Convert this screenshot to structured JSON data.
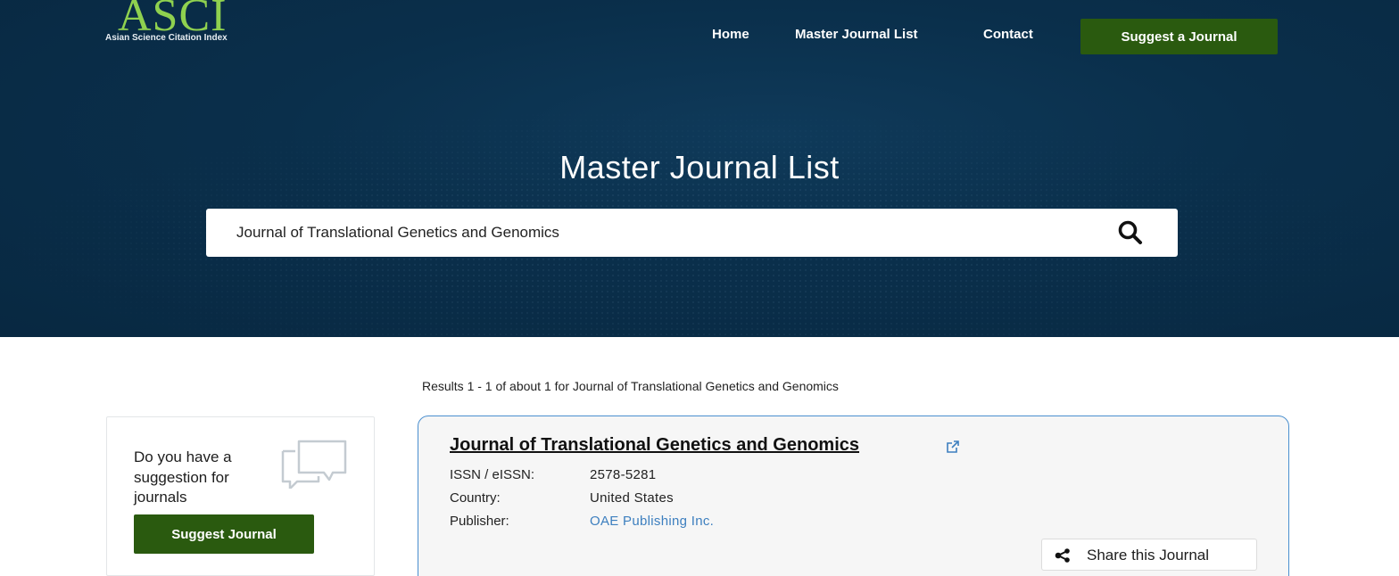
{
  "header": {
    "logo_text": "ASCI",
    "logo_subtitle": "Asian Science Citation Index",
    "nav": {
      "home": "Home",
      "master_journal_list": "Master Journal List",
      "contact": "Contact"
    },
    "suggest_button": "Suggest a Journal"
  },
  "hero": {
    "title": "Master Journal List",
    "search": {
      "value": "Journal of Translational Genetics and Genomics"
    }
  },
  "results": {
    "summary": "Results 1 - 1 of about 1 for Journal of Translational Genetics and Genomics"
  },
  "sidebar": {
    "prompt": "Do you have a suggestion for journals",
    "button": "Suggest Journal"
  },
  "journal": {
    "title": "Journal of Translational Genetics and Genomics",
    "issn_label": "ISSN / eISSN:",
    "issn_value": "2578-5281",
    "country_label": "Country:",
    "country_value": "United States",
    "publisher_label": "Publisher:",
    "publisher_value": "OAE Publishing Inc.",
    "share_button": "Share this Journal"
  },
  "colors": {
    "hero_bg": "#0a2f4b",
    "accent_green": "#2a5a0f",
    "logo_green": "#8fd14f",
    "link_blue": "#3d7fbf",
    "card_border": "#4a8fcf"
  }
}
